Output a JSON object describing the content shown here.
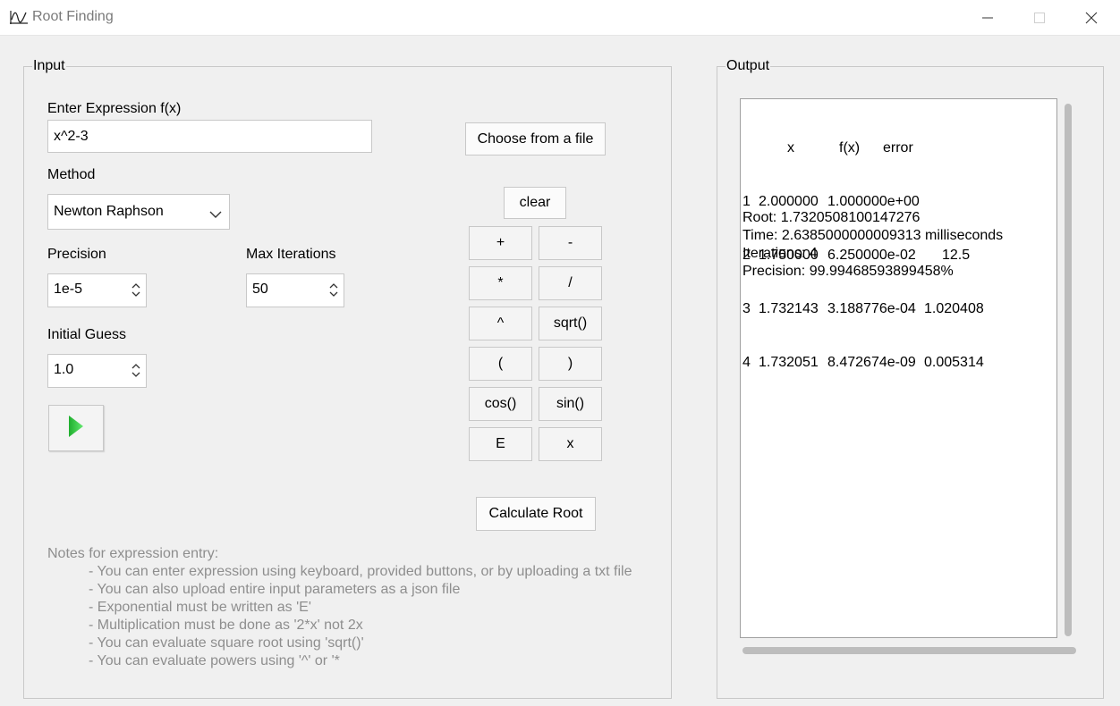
{
  "window": {
    "title": "Root Finding",
    "icon": "function-graph-icon",
    "controls": [
      "minimize-icon",
      "maximize-icon",
      "close-icon"
    ]
  },
  "input": {
    "group_label": "Input",
    "expression_label": "Enter Expression f(x)",
    "expression_value": "x^2-3",
    "method_label": "Method",
    "method_value": "Newton Raphson",
    "precision_label": "Precision",
    "precision_value": "1e-5",
    "max_iterations_label": "Max Iterations",
    "max_iterations_value": "50",
    "initial_guess_label": "Initial Guess",
    "initial_guess_value": "1.0",
    "play_icon": "play-icon",
    "choose_file_label": "Choose from a file",
    "clear_label": "clear",
    "keypad": [
      "+",
      "-",
      "*",
      "/",
      "^",
      "sqrt()",
      "(",
      ")",
      "cos()",
      "sin()",
      "E",
      "x"
    ],
    "calculate_label": "Calculate Root",
    "notes_title": "Notes for expression entry:",
    "notes": [
      "- You can enter expression using keyboard, provided buttons, or by uploading a txt file",
      "- You can also upload entire input parameters as a json file",
      "- Exponential must be written as 'E'",
      "- Multiplication must be done as '2*x' not 2x",
      "- You can evaluate square root using 'sqrt()'",
      "- You can evaluate powers using '^' or '*"
    ]
  },
  "output": {
    "group_label": "Output",
    "columns": [
      "x",
      "f(x)",
      "error"
    ],
    "rows": [
      {
        "i": "1",
        "x": "2.000000",
        "fx": "1.000000e+00",
        "error": ""
      },
      {
        "i": "2",
        "x": "1.750000",
        "fx": "6.250000e-02",
        "error": "12.5"
      },
      {
        "i": "3",
        "x": "1.732143",
        "fx": "3.188776e-04",
        "error": "1.020408"
      },
      {
        "i": "4",
        "x": "1.732051",
        "fx": "8.472674e-09",
        "error": "0.005314"
      }
    ],
    "root_line": "Root: 1.7320508100147276",
    "time_line": "Time: 2.6385000000009313 milliseconds",
    "iterations_line": "Iterations: 4",
    "precision_line": "Precision: 99.99468593899458%"
  },
  "colors": {
    "play_accent": "#2ecc40",
    "notes_text": "#8e8e8e",
    "background": "#f0f0f0"
  }
}
